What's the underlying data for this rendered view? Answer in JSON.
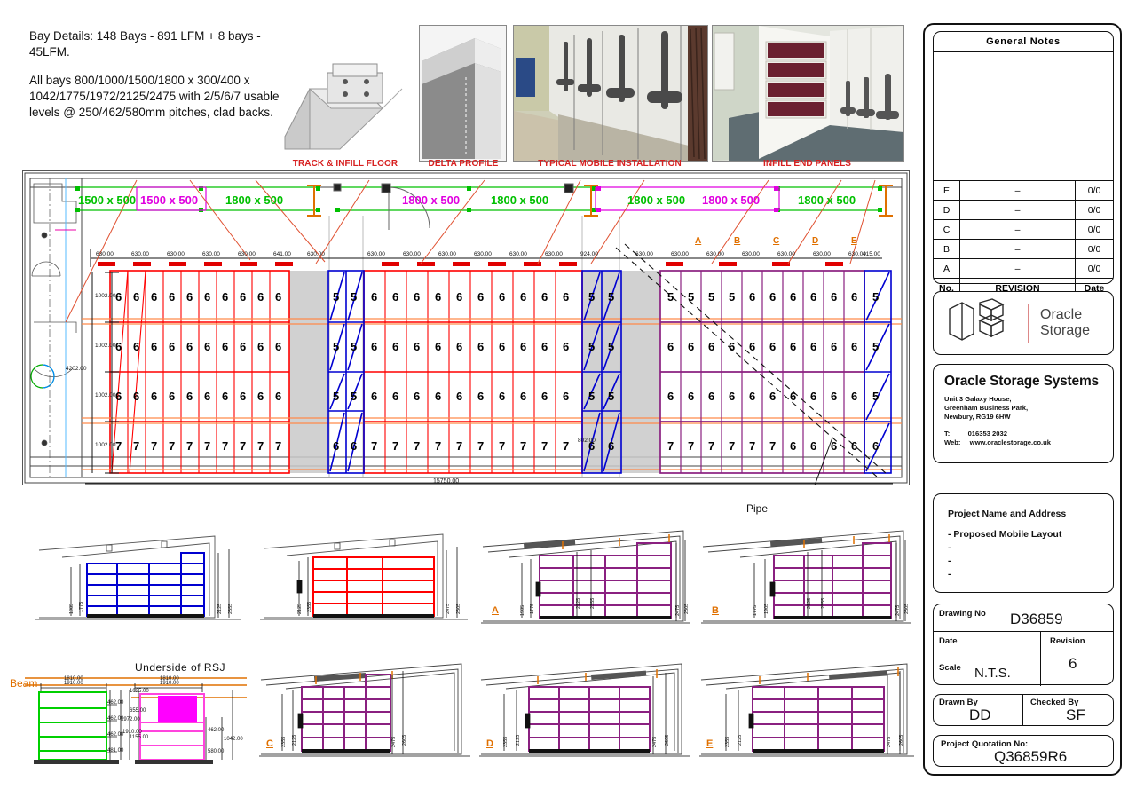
{
  "notes": {
    "line1": "Bay Details: 148 Bays - 891 LFM + 8 bays - 45LFM.",
    "line2": "All bays 800/1000/1500/1800 x 300/400 x 1042/1775/1972/2125/2475 with 2/5/6/7 usable levels @ 250/462/580mm pitches, clad backs."
  },
  "photo_captions": [
    "TRACK & INFILL FLOOR DETAIL",
    "DELTA PROFILE",
    "TYPICAL MOBILE INSTALLATION",
    "INFILL END PANELS"
  ],
  "title_block": {
    "general_notes_title": "General  Notes",
    "revision_rows": [
      {
        "no": "E",
        "revision": "–",
        "date": "0/0"
      },
      {
        "no": "D",
        "revision": "–",
        "date": "0/0"
      },
      {
        "no": "C",
        "revision": "–",
        "date": "0/0"
      },
      {
        "no": "B",
        "revision": "–",
        "date": "0/0"
      },
      {
        "no": "A",
        "revision": "–",
        "date": "0/0"
      }
    ],
    "revision_header": {
      "no": "No.",
      "revision": "REVISION",
      "date": "Date"
    },
    "logo": {
      "line1": "Oracle",
      "line2": "Storage"
    },
    "company": {
      "name": "Oracle Storage Systems",
      "address1": "Unit 3 Galaxy House,",
      "address2": "Greenham Business Park,",
      "address3": "Newbury, RG19 6HW",
      "tel_label": "T:",
      "tel_value": "016353 2032",
      "web_label": "Web:",
      "web_value": "www.oraclestorage.co.uk"
    },
    "project": {
      "heading": "Project Name and Address",
      "line1": "-  Proposed Mobile Layout",
      "line2": "-",
      "line3": "-",
      "line4": "-"
    },
    "drawing": {
      "drawing_no_label": "Drawing  No",
      "drawing_no_value": "D36859",
      "date_label": "Date",
      "date_value": "",
      "scale_label": "Scale",
      "scale_value": "N.T.S.",
      "revision_label": "Revision",
      "revision_value": "6"
    },
    "signoff": {
      "drawn_by_label": "Drawn  By",
      "drawn_by_value": "DD",
      "checked_by_label": "Checked  By",
      "checked_by_value": "SF"
    },
    "quotation": {
      "label": "Project  Quotation  No:",
      "value": "Q36859R6"
    }
  },
  "plan": {
    "aisle_labels": [
      {
        "text": "1500 x 500",
        "color": "green"
      },
      {
        "text": "1500 x 500",
        "color": "magenta"
      },
      {
        "text": "1800 x 500",
        "color": "green"
      },
      {
        "text": "1800 x 500",
        "color": "magenta"
      },
      {
        "text": "1800 x 500",
        "color": "green"
      },
      {
        "text": "1800 x 500",
        "color": "green"
      },
      {
        "text": "1800 x 500",
        "color": "magenta"
      },
      {
        "text": "1800 x 500",
        "color": "green"
      }
    ],
    "top_dims": [
      "630.00",
      "630.00",
      "630.00",
      "630.00",
      "630.00",
      "641.00",
      "630.00",
      "630.00",
      "630.00",
      "630.00",
      "630.00",
      "630.00",
      "630.00",
      "924.00",
      "630.00",
      "630.00",
      "630.00",
      "630.00",
      "630.00",
      "630.00",
      "630.00",
      "415.00"
    ],
    "column_letters": [
      "A",
      "B",
      "C",
      "D",
      "E"
    ],
    "left_dims": [
      "1002.00",
      "1002.00",
      "1002.00",
      "1002.00"
    ],
    "overall_left_dim": "4202.00",
    "bottom_dim": "15750.00",
    "inner_dim": "802.00",
    "pipe_label": "Pipe",
    "rows": [
      {
        "cells": [
          "6",
          "6",
          "6",
          "6",
          "6",
          "6",
          "6",
          "6",
          "6",
          "6"
        ],
        "color": "red"
      },
      {
        "cells": [
          "6",
          "6",
          "6",
          "6",
          "6",
          "6",
          "6",
          "6",
          "6",
          "6"
        ],
        "color": "red"
      },
      {
        "cells": [
          "6",
          "6",
          "6",
          "6",
          "6",
          "6",
          "6",
          "6",
          "6",
          "6"
        ],
        "color": "red"
      },
      {
        "cells": [
          "7",
          "7",
          "7",
          "7",
          "7",
          "7",
          "7",
          "7",
          "7",
          "7"
        ],
        "color": "red"
      }
    ],
    "blue_block_1": {
      "rows": [
        [
          "5",
          "5"
        ],
        [
          "5",
          "5"
        ],
        [
          "5",
          "5"
        ],
        [
          "6",
          "6"
        ]
      ]
    },
    "mid_block": {
      "rows": [
        [
          "6",
          "6",
          "6",
          "6",
          "6",
          "6",
          "6",
          "6",
          "6",
          "6"
        ],
        [
          "6",
          "6",
          "6",
          "6",
          "6",
          "6",
          "6",
          "6",
          "6",
          "6"
        ],
        [
          "6",
          "6",
          "6",
          "6",
          "6",
          "6",
          "6",
          "6",
          "6",
          "6"
        ],
        [
          "7",
          "7",
          "7",
          "7",
          "7",
          "7",
          "7",
          "7",
          "7",
          "7"
        ]
      ]
    },
    "blue_block_2": {
      "rows": [
        [
          "5",
          "5"
        ],
        [
          "5",
          "5"
        ],
        [
          "5",
          "5"
        ],
        [
          "6",
          "6"
        ]
      ]
    },
    "purple_block": {
      "rows": [
        [
          "5",
          "5",
          "5",
          "5",
          "6",
          "6",
          "6",
          "6",
          "6",
          "6"
        ],
        [
          "6",
          "6",
          "6",
          "6",
          "6",
          "6",
          "6",
          "6",
          "6",
          "6"
        ],
        [
          "6",
          "6",
          "6",
          "6",
          "6",
          "6",
          "6",
          "6",
          "6",
          "6"
        ],
        [
          "7",
          "7",
          "7",
          "7",
          "7",
          "7",
          "6",
          "6",
          "6",
          "6"
        ]
      ],
      "end_column": [
        "5",
        "5",
        "5",
        "6"
      ]
    }
  },
  "elevations": {
    "labels": [
      "A",
      "B",
      "C",
      "D",
      "E"
    ],
    "dims_blue": [
      "1905",
      "1775",
      "2125",
      "2355"
    ],
    "dims_red": [
      "2125",
      "2355",
      "2475",
      "2605"
    ],
    "dims_purple": [
      "1905",
      "1775",
      "2125",
      "2355",
      "2475",
      "2605"
    ]
  },
  "details": {
    "rsj_label": "Underside  of  RSJ",
    "beam_label": "Beam",
    "left_dims": [
      "1810.00",
      "1910.00",
      "462.00",
      "462.00",
      "462.00",
      "481.00",
      "1972.00",
      "1910.00"
    ],
    "right_dims": [
      "1810.00",
      "1910.00",
      "1025.00",
      "655.00",
      "1155.00",
      "462.00",
      "580.00",
      "1042.00"
    ]
  },
  "colors": {
    "red_bay": "#ff0000",
    "blue_bay": "#0000d0",
    "purple_bay": "#8a2080",
    "green_dim": "#00c000",
    "magenta_dim": "#e000e0",
    "orange": "#e07000",
    "caption_red": "#d72020"
  }
}
